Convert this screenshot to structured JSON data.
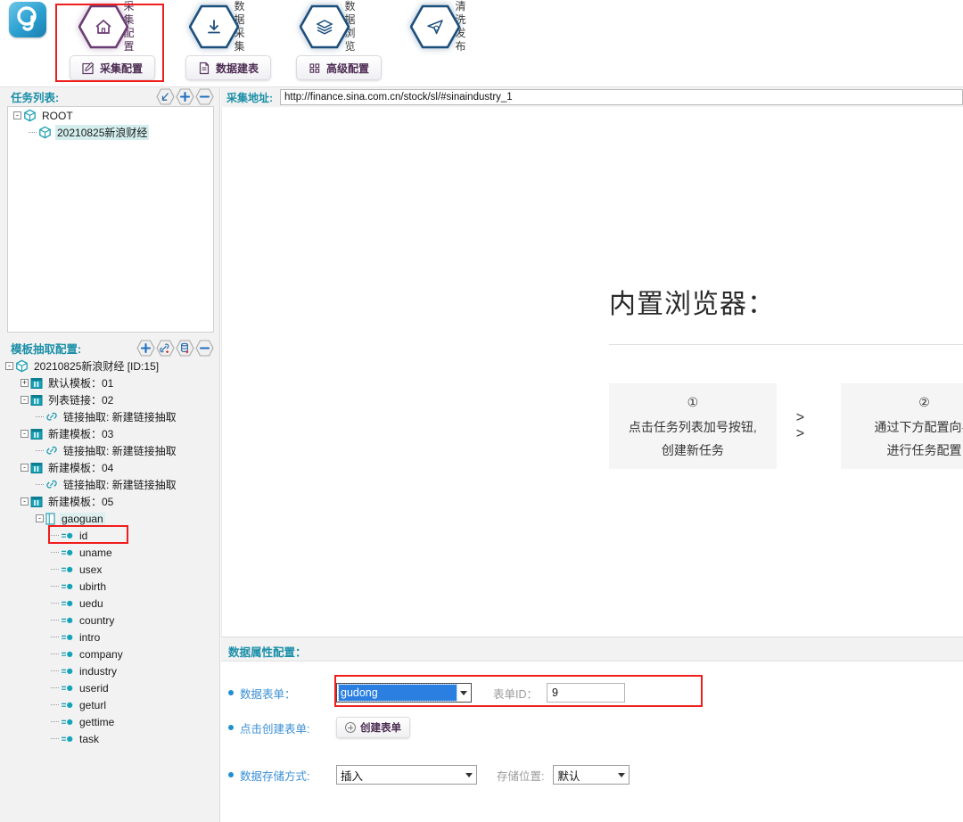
{
  "app": {
    "logo_icon": "app-logo-icon"
  },
  "ribbon": {
    "hex_items": [
      {
        "id": "collect-config",
        "icon": "home-icon",
        "line1": "采集",
        "line2": "配置",
        "accent": "#6b3c74",
        "selected": true
      },
      {
        "id": "data-collect",
        "icon": "download-icon",
        "line1": "数据",
        "line2": "采集",
        "accent": "#1c4f7c",
        "selected": false
      },
      {
        "id": "data-browse",
        "icon": "layers-icon",
        "line1": "数据",
        "line2": "浏览",
        "accent": "#1c4f7c",
        "selected": false
      },
      {
        "id": "clean-publish",
        "icon": "send-icon",
        "line1": "清洗",
        "line2": "发布",
        "accent": "#1c4f7c",
        "selected": false
      }
    ],
    "buttons": [
      {
        "id": "collect-config-button",
        "label": "采集配置",
        "icon": "pencil-square-icon",
        "active": true
      },
      {
        "id": "build-table-button",
        "label": "数据建表",
        "icon": "document-icon",
        "active": false
      },
      {
        "id": "advanced-config-button",
        "label": "高级配置",
        "icon": "grid-dots-icon",
        "active": false
      }
    ]
  },
  "task_panel": {
    "title": "任务列表:",
    "tools": [
      {
        "id": "import-task",
        "icon": "import-arrow-icon",
        "glyph": "↘"
      },
      {
        "id": "add-task",
        "icon": "plus-icon",
        "glyph": "+"
      },
      {
        "id": "remove-task",
        "icon": "minus-icon",
        "glyph": "−"
      }
    ],
    "tree": [
      {
        "depth": 0,
        "toggle": "-",
        "icon": "cube-icon",
        "label": "ROOT",
        "selected": false
      },
      {
        "depth": 1,
        "toggle": "",
        "icon": "cube-icon",
        "label": "20210825新浪财经",
        "selected": true
      }
    ]
  },
  "template_panel": {
    "title": "模板抽取配置:",
    "tools": [
      {
        "id": "add-template",
        "icon": "plus-icon",
        "glyph": "+"
      },
      {
        "id": "add-link-extract",
        "icon": "link-add-icon",
        "glyph": ""
      },
      {
        "id": "add-data-extract",
        "icon": "database-add-icon",
        "glyph": ""
      },
      {
        "id": "remove-node",
        "icon": "minus-icon",
        "glyph": "−"
      }
    ],
    "tree": [
      {
        "depth": 0,
        "toggle": "-",
        "icon": "cube-icon",
        "label": "20210825新浪财经 [ID:15]",
        "selected": false
      },
      {
        "depth": 1,
        "toggle": "+",
        "icon": "template-icon",
        "label": "默认模板：01",
        "selected": false
      },
      {
        "depth": 1,
        "toggle": "-",
        "icon": "template-icon",
        "label": "列表链接：02",
        "selected": false
      },
      {
        "depth": 2,
        "toggle": "",
        "icon": "link-icon",
        "label": "链接抽取: 新建链接抽取",
        "selected": false
      },
      {
        "depth": 1,
        "toggle": "-",
        "icon": "template-icon",
        "label": "新建模板：03",
        "selected": false
      },
      {
        "depth": 2,
        "toggle": "",
        "icon": "link-icon",
        "label": "链接抽取: 新建链接抽取",
        "selected": false
      },
      {
        "depth": 1,
        "toggle": "-",
        "icon": "template-icon",
        "label": "新建模板：04",
        "selected": false
      },
      {
        "depth": 2,
        "toggle": "",
        "icon": "link-icon",
        "label": "链接抽取: 新建链接抽取",
        "selected": false
      },
      {
        "depth": 1,
        "toggle": "-",
        "icon": "template-icon",
        "label": "新建模板：05",
        "selected": false
      },
      {
        "depth": 2,
        "toggle": "-",
        "icon": "table-icon",
        "label": "gaoguan",
        "selected": true
      },
      {
        "depth": 3,
        "toggle": "",
        "icon": "field-icon",
        "label": "id",
        "selected": false
      },
      {
        "depth": 3,
        "toggle": "",
        "icon": "field-icon",
        "label": "uname",
        "selected": false
      },
      {
        "depth": 3,
        "toggle": "",
        "icon": "field-icon",
        "label": "usex",
        "selected": false
      },
      {
        "depth": 3,
        "toggle": "",
        "icon": "field-icon",
        "label": "ubirth",
        "selected": false
      },
      {
        "depth": 3,
        "toggle": "",
        "icon": "field-icon",
        "label": "uedu",
        "selected": false
      },
      {
        "depth": 3,
        "toggle": "",
        "icon": "field-icon",
        "label": "country",
        "selected": false
      },
      {
        "depth": 3,
        "toggle": "",
        "icon": "field-icon",
        "label": "intro",
        "selected": false
      },
      {
        "depth": 3,
        "toggle": "",
        "icon": "field-icon",
        "label": "company",
        "selected": false
      },
      {
        "depth": 3,
        "toggle": "",
        "icon": "field-icon",
        "label": "industry",
        "selected": false
      },
      {
        "depth": 3,
        "toggle": "",
        "icon": "field-icon",
        "label": "userid",
        "selected": false
      },
      {
        "depth": 3,
        "toggle": "",
        "icon": "field-icon",
        "label": "geturl",
        "selected": false
      },
      {
        "depth": 3,
        "toggle": "",
        "icon": "field-icon",
        "label": "gettime",
        "selected": false
      },
      {
        "depth": 3,
        "toggle": "",
        "icon": "field-icon",
        "label": "task",
        "selected": false
      }
    ]
  },
  "url_bar": {
    "label": "采集地址:",
    "value": "http://finance.sina.com.cn/stock/sl/#sinaindustry_1",
    "placeholder": ""
  },
  "browser": {
    "title": "内置浏览器：",
    "steps": [
      {
        "num": "①",
        "line1": "点击任务列表加号按钮,",
        "line2": "创建新任务"
      },
      {
        "num": "②",
        "line1": "通过下方配置向导",
        "line2": "进行任务配置"
      }
    ],
    "arrow": "> >"
  },
  "data_config": {
    "title": "数据属性配置：",
    "form_label": "数据表单：",
    "form_value": "gudong",
    "form_id_label": "表单ID：",
    "form_id_value": "9",
    "create_label": "点击创建表单:",
    "create_button": "创建表单",
    "create_button_icon": "circle-plus-icon",
    "store_mode_label": "数据存储方式:",
    "store_mode_value": "插入",
    "store_location_label": "存储位置:",
    "store_location_value": "默认"
  },
  "colors": {
    "panel_title": "#1b8fa8",
    "field_label": "#3b8fd4",
    "highlight_red": "#f01d1d",
    "select_blue": "#2a7fe0",
    "tree_select": "#d4eeee"
  }
}
